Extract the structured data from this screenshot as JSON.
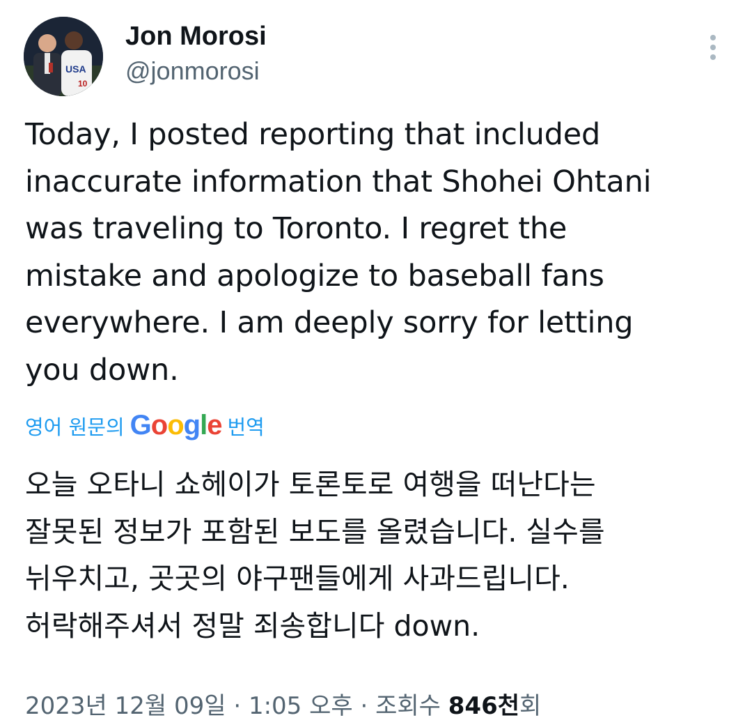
{
  "author": {
    "display_name": "Jon Morosi",
    "handle": "@jonmorosi"
  },
  "tweet": {
    "text": "Today, I posted reporting that included\ninaccurate information that Shohei Ohtani\nwas traveling to Toronto. I regret the\nmistake and apologize to baseball fans\neverywhere. I am deeply sorry for letting\nyou down."
  },
  "translation": {
    "prefix": "영어 원문의",
    "google_letters": [
      "G",
      "o",
      "o",
      "g",
      "l",
      "e"
    ],
    "google_colors": [
      "#4285F4",
      "#EA4335",
      "#FBBC05",
      "#4285F4",
      "#34A853",
      "#EA4335"
    ],
    "suffix": "번역",
    "text": "오늘 오타니 쇼헤이가 토론토로 여행을 떠난다는\n잘못된 정보가 포함된 보도를 올렸습니다. 실수를\n뉘우치고, 곳곳의 야구팬들에게 사과드립니다.\n허락해주셔서 정말 죄송합니다 down."
  },
  "meta": {
    "date": "2023년 12월 09일",
    "separator": "·",
    "time": "1:05 오후",
    "views_label": "조회수",
    "views_count": "846천",
    "views_suffix": "회"
  },
  "colors": {
    "text": "#0f1419",
    "secondary": "#536471",
    "link": "#1d9bf0"
  },
  "icons": {
    "more": "more-vertical-icon"
  }
}
